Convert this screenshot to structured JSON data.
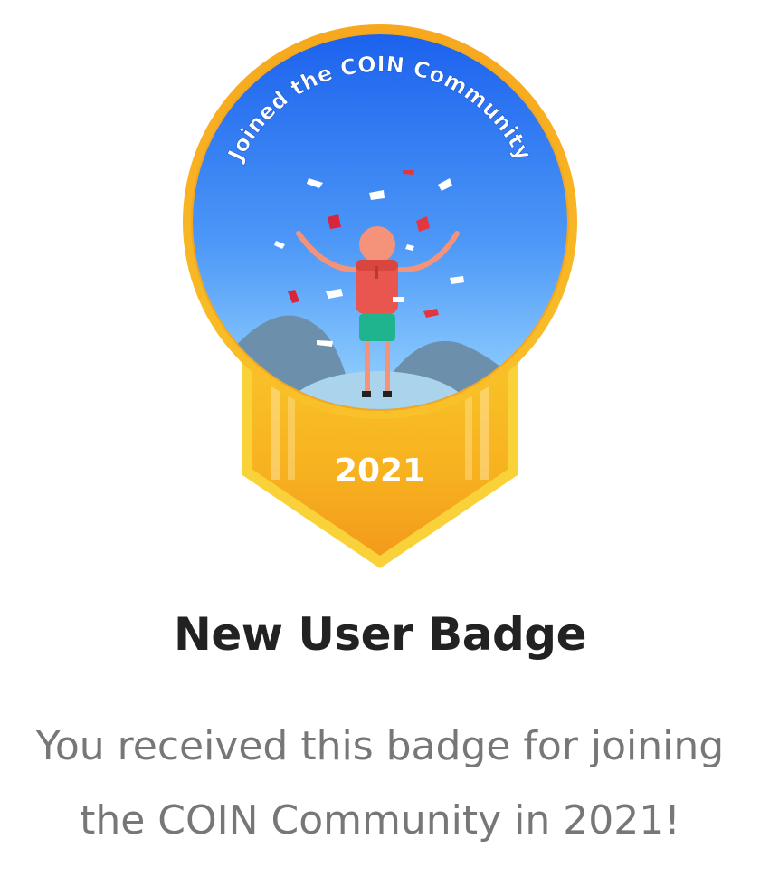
{
  "badge": {
    "arc_text": "Joined the COIN Community",
    "year": "2021",
    "colors": {
      "gold": "#F7B51E",
      "gold_dark": "#F39A1C",
      "sky_top": "#1F6BF0",
      "sky_bottom": "#8FD3FF",
      "mountain": "#6F93AF",
      "shirt": "#E8564F",
      "shorts": "#1FB38E",
      "skin": "#F4927A"
    }
  },
  "title": "New User Badge",
  "description": "You received this badge for joining the COIN Community in 2021!"
}
